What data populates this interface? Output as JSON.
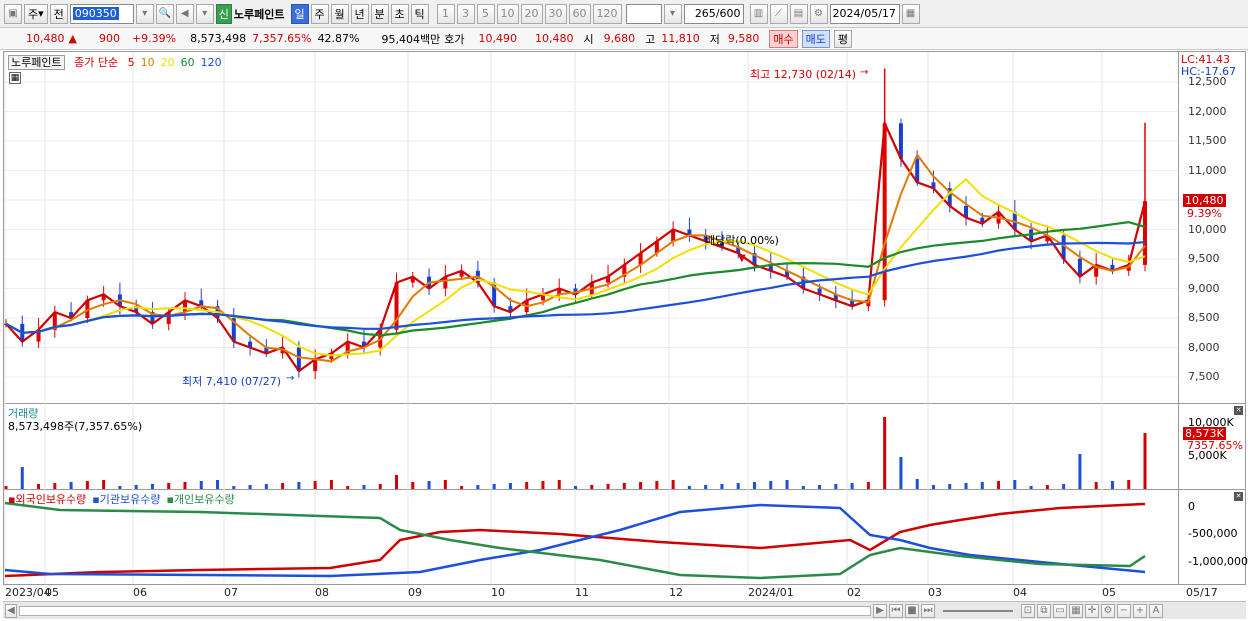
{
  "toolbar": {
    "mode": "주",
    "prev_label": "전",
    "code": "090350",
    "badge": "신",
    "stock_name": "노루페인트",
    "periods": [
      "일",
      "주",
      "월",
      "년",
      "분",
      "초",
      "틱"
    ],
    "active_period": "일",
    "intervals": [
      "1",
      "3",
      "5",
      "10",
      "20",
      "30",
      "60",
      "120"
    ],
    "count": "265",
    "count_max": "/600",
    "date": "2024/05/17"
  },
  "quote": {
    "price": "10,480",
    "change_arrow": "▲",
    "change": "900",
    "change_pct": "+9.39%",
    "volume": "8,573,498",
    "volume_pct": "7,357.65%",
    "turnover_pct": "42.87%",
    "amount": "95,404백만",
    "bid_label": "호가",
    "bid1": "10,490",
    "bid2": "10,480",
    "open_label": "시",
    "open": "9,680",
    "high_label": "고",
    "high": "11,810",
    "low_label": "저",
    "low": "9,580",
    "buy_button": "매수",
    "sell_button": "매도",
    "eval_button": "평"
  },
  "price_panel": {
    "stock_tab": "노루페인트",
    "ma_title": "종가 단순",
    "ma_periods": [
      {
        "label": "5",
        "color": "#d00000"
      },
      {
        "label": "10",
        "color": "#e07b00"
      },
      {
        "label": "20",
        "color": "#f2e000"
      },
      {
        "label": "60",
        "color": "#1a8a2a"
      },
      {
        "label": "120",
        "color": "#1c50d8"
      }
    ],
    "lc": "LC:41.43",
    "hc": "HC:-17.67",
    "high_annotation": "최고 12,730 (02/14)",
    "low_annotation": "최저 7,410 (07/27)",
    "dividend_annotation": "배당락(0.00%)",
    "current_price_tag": "10,480",
    "current_pct_tag": "9.39%",
    "y_ticks": [
      "12,500",
      "12,000",
      "11,500",
      "11,000",
      "10,500",
      "10,000",
      "9,500",
      "9,000",
      "8,500",
      "8,000",
      "7,500"
    ]
  },
  "volume_panel": {
    "title": "거래량",
    "value": "8,573,498주(7,357.65%)",
    "tag_value": "8,573K",
    "tag_pct": "7357.65%",
    "y_ticks": [
      "10,000K",
      "5,000K"
    ]
  },
  "holding_panel": {
    "legend": [
      {
        "label": "외국인보유수량",
        "color": "#d00000"
      },
      {
        "label": "기관보유수량",
        "color": "#1c50d8"
      },
      {
        "label": "개인보유수량",
        "color": "#2a8a4a"
      }
    ],
    "y_ticks": [
      "0",
      "-500,000",
      "-1,000,000"
    ]
  },
  "x_axis": {
    "labels": [
      "2023/04",
      "05",
      "06",
      "07",
      "08",
      "09",
      "10",
      "11",
      "12",
      "2024/01",
      "02",
      "03",
      "04",
      "05"
    ],
    "right_label": "05/17"
  },
  "chart_data": {
    "type": "line",
    "title": "",
    "x_range": [
      "2023/04",
      "2024/05/17"
    ],
    "ylim": [
      7200,
      12800
    ],
    "price_series": [
      {
        "name": "종가",
        "values": [
          8400,
          8100,
          8300,
          8600,
          8500,
          8800,
          8900,
          8700,
          8600,
          8400,
          8600,
          8800,
          8700,
          8500,
          8100,
          8000,
          7900,
          8000,
          7600,
          7800,
          7900,
          8100,
          8000,
          8300,
          9100,
          9200,
          9000,
          9200,
          9300,
          9100,
          8700,
          8600,
          8800,
          8900,
          9000,
          8900,
          9100,
          9200,
          9400,
          9600,
          9800,
          10000,
          9900,
          9800,
          9700,
          9600,
          9400,
          9300,
          9200,
          9000,
          8900,
          8800,
          8700,
          8800,
          11800,
          11200,
          10800,
          10700,
          10400,
          10200,
          10100,
          10300,
          10000,
          9800,
          9900,
          9500,
          9200,
          9400,
          9300,
          9400,
          10480
        ]
      }
    ]
  }
}
